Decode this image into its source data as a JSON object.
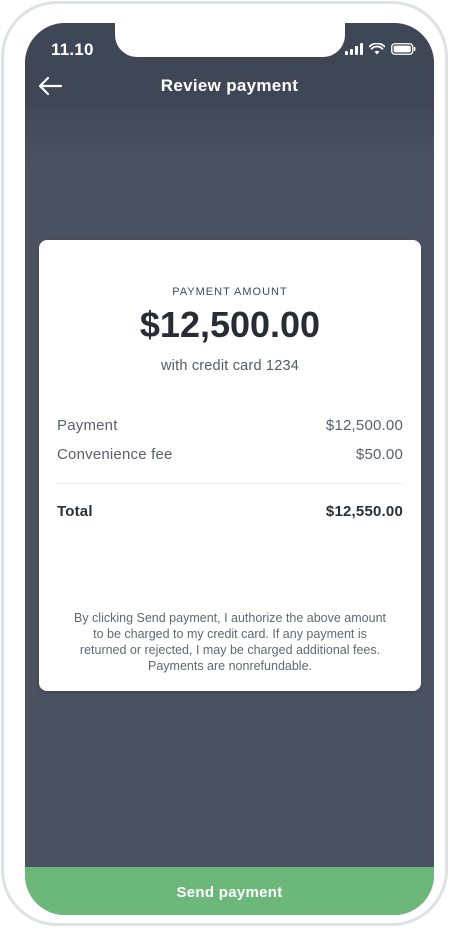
{
  "status_bar": {
    "time": "11.10",
    "icons": [
      "signal-icon",
      "wifi-icon",
      "battery-icon"
    ]
  },
  "header": {
    "title": "Review payment",
    "back_icon": "arrow-left-icon"
  },
  "summary": {
    "label": "PAYMENT AMOUNT",
    "amount": "$12,500.00",
    "method": "with credit card 1234"
  },
  "line_items": [
    {
      "label": "Payment",
      "value": "$12,500.00"
    },
    {
      "label": "Convenience fee",
      "value": "$50.00"
    }
  ],
  "total": {
    "label": "Total",
    "value": "$12,550.00"
  },
  "disclaimer": "By clicking Send payment, I authorize the above amount to be charged to my credit card. If any payment is returned or rejected, I may be charged additional fees. Payments are nonrefundable.",
  "actions": {
    "send_label": "Send payment"
  },
  "colors": {
    "header_bg": "#3f4655",
    "overlay_bg": "#4b5362",
    "accent_green": "#6cb87a"
  }
}
